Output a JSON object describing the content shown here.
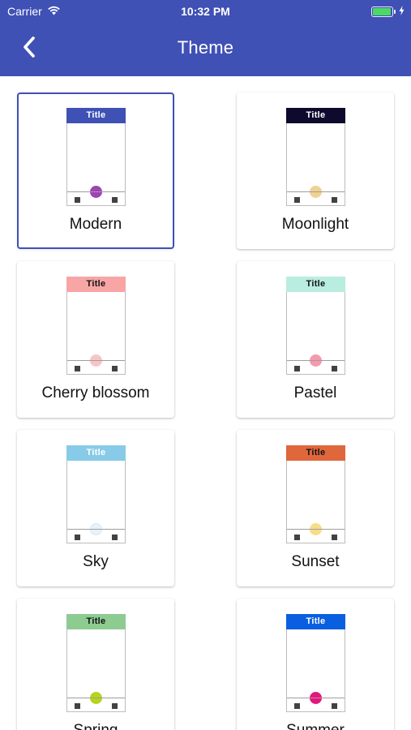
{
  "status": {
    "carrier": "Carrier",
    "time": "10:32 PM",
    "battery_color": "#4cd964"
  },
  "nav": {
    "title": "Theme",
    "back_icon": "chevron-left-icon",
    "background": "#3f51b5"
  },
  "preview": {
    "header_title": "Title"
  },
  "themes": [
    {
      "name": "Modern",
      "header_bg": "#3f51b5",
      "header_fg": "#ffffff",
      "fab": "#a142b3",
      "selected": true
    },
    {
      "name": "Moonlight",
      "header_bg": "#0d0a2e",
      "header_fg": "#ffffff",
      "fab": "#f0d191",
      "selected": false
    },
    {
      "name": "Cherry blossom",
      "header_bg": "#f8a5a5",
      "header_fg": "#111111",
      "fab": "#f7c4c8",
      "selected": false
    },
    {
      "name": "Pastel",
      "header_bg": "#b9ede0",
      "header_fg": "#111111",
      "fab": "#f49aae",
      "selected": false
    },
    {
      "name": "Sky",
      "header_bg": "#87cbe8",
      "header_fg": "#ffffff",
      "fab": "#e6f3f9",
      "selected": false
    },
    {
      "name": "Sunset",
      "header_bg": "#e0663c",
      "header_fg": "#111111",
      "fab": "#f7dc8a",
      "selected": false
    },
    {
      "name": "Spring",
      "header_bg": "#8dcb91",
      "header_fg": "#111111",
      "fab": "#b6d41c",
      "selected": false
    },
    {
      "name": "Summer",
      "header_bg": "#0a5fe0",
      "header_fg": "#ffffff",
      "fab": "#e5157e",
      "selected": false
    }
  ]
}
